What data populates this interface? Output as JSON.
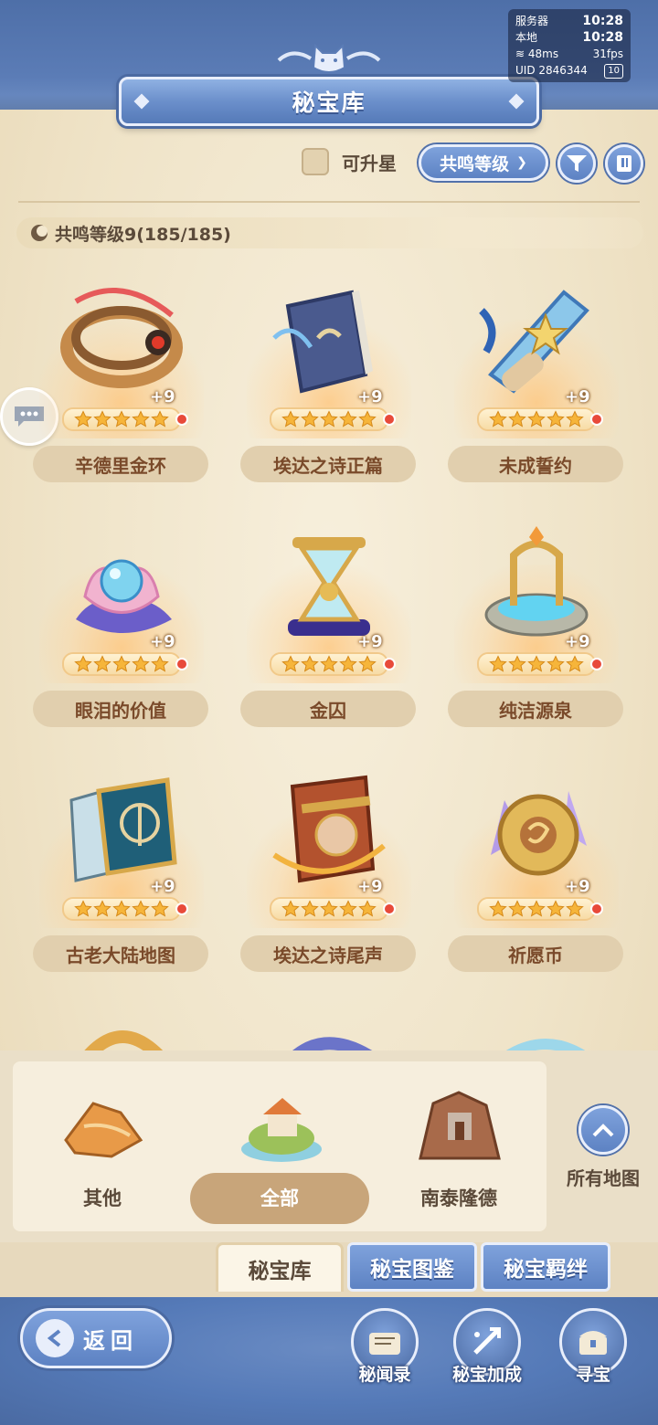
{
  "header": {
    "title": "秘宝库"
  },
  "status": {
    "server_label": "服务器",
    "server_time": "10:28",
    "local_label": "本地",
    "local_time": "10:28",
    "ping": "48ms",
    "fps": "31fps",
    "uid": "UID 2846344",
    "badge": "10"
  },
  "filter": {
    "checkbox_label": "可升星",
    "sort_label": "共鸣等级"
  },
  "level_bar": {
    "text": "共鸣等级9(185/185)"
  },
  "items": [
    {
      "name": "辛德里金环",
      "plus": "+9",
      "stars": 5
    },
    {
      "name": "埃达之诗正篇",
      "plus": "+9",
      "stars": 5
    },
    {
      "name": "未成誓约",
      "plus": "+9",
      "stars": 5
    },
    {
      "name": "眼泪的价值",
      "plus": "+9",
      "stars": 5
    },
    {
      "name": "金囚",
      "plus": "+9",
      "stars": 5
    },
    {
      "name": "纯洁源泉",
      "plus": "+9",
      "stars": 5
    },
    {
      "name": "古老大陆地图",
      "plus": "+9",
      "stars": 5
    },
    {
      "name": "埃达之诗尾声",
      "plus": "+9",
      "stars": 5
    },
    {
      "name": "祈愿币",
      "plus": "+9",
      "stars": 5
    }
  ],
  "regions": [
    {
      "label": "其他"
    },
    {
      "label": "全部"
    },
    {
      "label": "南泰隆德"
    }
  ],
  "all_maps": {
    "label": "所有地图"
  },
  "tabs": [
    {
      "label": "秘宝库"
    },
    {
      "label": "秘宝图鉴"
    },
    {
      "label": "秘宝羁绊"
    }
  ],
  "back": {
    "label": "返回"
  },
  "actions": [
    {
      "label": "秘闻录"
    },
    {
      "label": "秘宝加成"
    },
    {
      "label": "寻宝"
    }
  ]
}
